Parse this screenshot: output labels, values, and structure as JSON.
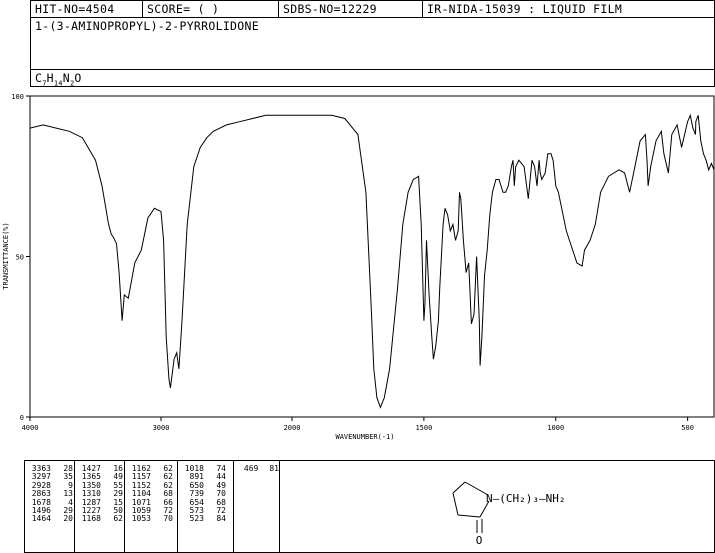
{
  "header": {
    "hit_no": "HIT-NO=4504",
    "score": "SCORE=  (   )",
    "sdbs_no": "SDBS-NO=12229",
    "ir_info": "IR-NIDA-15039 : LIQUID FILM"
  },
  "compound_name": "1-(3-AMINOPROPYL)-2-PYRROLIDONE",
  "formula": {
    "base": "C",
    "c": "7",
    "h_label": "H",
    "h": "14",
    "n_label": "N",
    "n": "2",
    "o_label": "O"
  },
  "chart_data": {
    "type": "line",
    "title": "",
    "xlabel": "WAVENUMBER(-1)",
    "ylabel": "TRANSMITTANCE(%)",
    "xlim": [
      4000,
      400
    ],
    "ylim": [
      0,
      100
    ],
    "x_ticks": [
      "4000",
      "3000",
      "2000",
      "1500",
      "1000",
      "500"
    ],
    "y_ticks": [
      "100",
      "50",
      "0"
    ],
    "series": [
      {
        "x": [
          4000,
          3900,
          3800,
          3700,
          3600,
          3500,
          3450,
          3400,
          3380,
          3363,
          3340,
          3320,
          3297,
          3280,
          3250,
          3200,
          3150,
          3100,
          3050,
          3000,
          2980,
          2960,
          2940,
          2928,
          2900,
          2880,
          2863,
          2840,
          2820,
          2800,
          2750,
          2700,
          2650,
          2600,
          2500,
          2400,
          2300,
          2200,
          2100,
          2000,
          1900,
          1850,
          1800,
          1750,
          1720,
          1700,
          1690,
          1678,
          1665,
          1650,
          1630,
          1600,
          1580,
          1560,
          1540,
          1520,
          1510,
          1500,
          1496,
          1490,
          1480,
          1470,
          1464,
          1455,
          1445,
          1440,
          1427,
          1420,
          1410,
          1400,
          1390,
          1380,
          1370,
          1365,
          1360,
          1350,
          1340,
          1330,
          1320,
          1310,
          1300,
          1290,
          1287,
          1280,
          1270,
          1260,
          1250,
          1240,
          1227,
          1215,
          1200,
          1190,
          1180,
          1168,
          1162,
          1157,
          1152,
          1140,
          1120,
          1104,
          1090,
          1080,
          1071,
          1063,
          1059,
          1053,
          1040,
          1030,
          1018,
          1010,
          1000,
          990,
          960,
          920,
          900,
          891,
          870,
          850,
          830,
          800,
          780,
          760,
          739,
          720,
          700,
          680,
          660,
          654,
          650,
          640,
          620,
          600,
          590,
          573,
          560,
          540,
          523,
          500,
          490,
          480,
          470,
          469,
          460,
          450,
          440,
          430,
          420,
          410,
          400
        ],
        "y": [
          90,
          91,
          90,
          89,
          87,
          80,
          72,
          60,
          57,
          56,
          54,
          45,
          30,
          38,
          37,
          48,
          52,
          62,
          65,
          64,
          55,
          25,
          12,
          9,
          18,
          20,
          15,
          30,
          45,
          60,
          78,
          84,
          87,
          89,
          91,
          92,
          93,
          94,
          94,
          94,
          94,
          94,
          93,
          88,
          70,
          35,
          15,
          6,
          3,
          6,
          15,
          40,
          60,
          70,
          74,
          75,
          60,
          30,
          35,
          55,
          38,
          25,
          18,
          22,
          30,
          40,
          60,
          65,
          63,
          58,
          60,
          55,
          58,
          70,
          68,
          55,
          45,
          48,
          29,
          32,
          50,
          30,
          16,
          25,
          44,
          52,
          63,
          70,
          74,
          74,
          70,
          70,
          72,
          78,
          80,
          72,
          78,
          80,
          78,
          68,
          80,
          78,
          72,
          80,
          76,
          74,
          76,
          82,
          82,
          80,
          72,
          70,
          58,
          48,
          47,
          52,
          55,
          60,
          70,
          75,
          76,
          77,
          76,
          70,
          78,
          86,
          88,
          80,
          72,
          78,
          86,
          89,
          82,
          76,
          88,
          91,
          84,
          92,
          94,
          90,
          88,
          92,
          94,
          86,
          82,
          80,
          77,
          79,
          77
        ]
      }
    ]
  },
  "peak_columns": [
    [
      [
        "3363",
        "28"
      ],
      [
        "3297",
        "35"
      ],
      [
        "2928",
        "9"
      ],
      [
        "2863",
        "13"
      ],
      [
        "1678",
        "4"
      ],
      [
        "1496",
        "29"
      ],
      [
        "1464",
        "20"
      ]
    ],
    [
      [
        "1427",
        "16"
      ],
      [
        "1365",
        "49"
      ],
      [
        "1350",
        "55"
      ],
      [
        "1310",
        "29"
      ],
      [
        "1287",
        "15"
      ],
      [
        "1227",
        "50"
      ],
      [
        "1168",
        "62"
      ]
    ],
    [
      [
        "1162",
        "62"
      ],
      [
        "1157",
        "62"
      ],
      [
        "1152",
        "62"
      ],
      [
        "1104",
        "68"
      ],
      [
        "1071",
        "66"
      ],
      [
        "1059",
        "72"
      ],
      [
        "1053",
        "70"
      ]
    ],
    [
      [
        "1018",
        "74"
      ],
      [
        "891",
        "44"
      ],
      [
        "650",
        "49"
      ],
      [
        "739",
        "70"
      ],
      [
        "654",
        "68"
      ],
      [
        "573",
        "72"
      ],
      [
        "523",
        "84"
      ]
    ],
    [
      [
        "469",
        "81"
      ]
    ]
  ],
  "structure": {
    "label": "N—(CH₂)₃—NH₂",
    "carbonyl": "O"
  }
}
